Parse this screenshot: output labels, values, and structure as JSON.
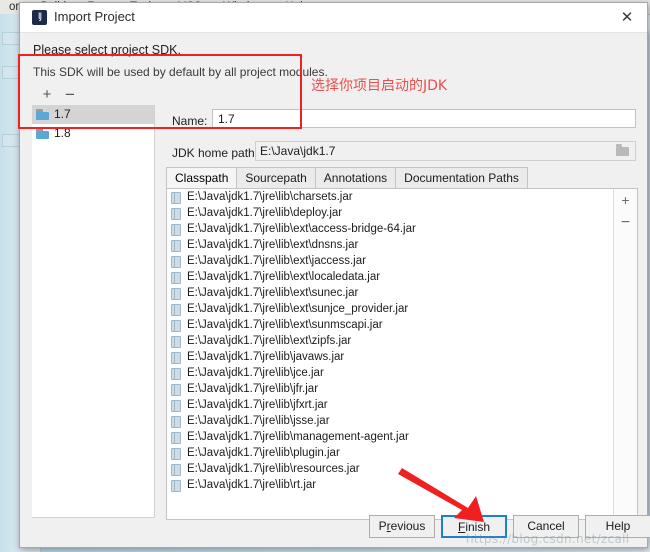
{
  "ide": {
    "menubar": [
      "or",
      "Build",
      "Run",
      "Tools",
      "VCS",
      "Window",
      "Help"
    ]
  },
  "dialog": {
    "title": "Import Project",
    "app_icon": "intellij-idea-icon",
    "close_icon": "✕",
    "heading_primary": "Please select project SDK.",
    "heading_secondary": "This SDK will be used by default by all project modules."
  },
  "sdk_panel": {
    "add_label": "+",
    "remove_label": "−",
    "items": [
      {
        "label": "1.7",
        "selected": true
      },
      {
        "label": "1.8",
        "selected": false
      }
    ]
  },
  "detail": {
    "name_label": "Name:",
    "name_value": "1.7",
    "name_placeholder": "",
    "jdk_path_label": "JDK home path:",
    "jdk_path_value": "E:\\Java\\jdk1.7",
    "browse_icon": "folder-icon"
  },
  "tabs": [
    {
      "label": "Classpath",
      "active": true
    },
    {
      "label": "Sourcepath",
      "active": false
    },
    {
      "label": "Annotations",
      "active": false
    },
    {
      "label": "Documentation Paths",
      "active": false
    }
  ],
  "classpath": {
    "add_label": "+",
    "remove_label": "−",
    "entries": [
      "E:\\Java\\jdk1.7\\jre\\lib\\charsets.jar",
      "E:\\Java\\jdk1.7\\jre\\lib\\deploy.jar",
      "E:\\Java\\jdk1.7\\jre\\lib\\ext\\access-bridge-64.jar",
      "E:\\Java\\jdk1.7\\jre\\lib\\ext\\dnsns.jar",
      "E:\\Java\\jdk1.7\\jre\\lib\\ext\\jaccess.jar",
      "E:\\Java\\jdk1.7\\jre\\lib\\ext\\localedata.jar",
      "E:\\Java\\jdk1.7\\jre\\lib\\ext\\sunec.jar",
      "E:\\Java\\jdk1.7\\jre\\lib\\ext\\sunjce_provider.jar",
      "E:\\Java\\jdk1.7\\jre\\lib\\ext\\sunmscapi.jar",
      "E:\\Java\\jdk1.7\\jre\\lib\\ext\\zipfs.jar",
      "E:\\Java\\jdk1.7\\jre\\lib\\javaws.jar",
      "E:\\Java\\jdk1.7\\jre\\lib\\jce.jar",
      "E:\\Java\\jdk1.7\\jre\\lib\\jfr.jar",
      "E:\\Java\\jdk1.7\\jre\\lib\\jfxrt.jar",
      "E:\\Java\\jdk1.7\\jre\\lib\\jsse.jar",
      "E:\\Java\\jdk1.7\\jre\\lib\\management-agent.jar",
      "E:\\Java\\jdk1.7\\jre\\lib\\plugin.jar",
      "E:\\Java\\jdk1.7\\jre\\lib\\resources.jar",
      "E:\\Java\\jdk1.7\\jre\\lib\\rt.jar"
    ]
  },
  "buttons": {
    "previous": {
      "pre": "P",
      "mn": "r",
      "post": "evious"
    },
    "finish": {
      "pre": "",
      "mn": "F",
      "post": "inish"
    },
    "cancel": {
      "pre": "",
      "mn": "",
      "post": "Cancel"
    },
    "help": {
      "pre": "",
      "mn": "",
      "post": "Help"
    }
  },
  "annotations": {
    "note_text": "选择你项目启动的JDK",
    "note_color": "#ef4d4d",
    "rect_color": "#ee2222",
    "arrow_color": "#f02020",
    "watermark": "https://blog.csdn.net/zcall"
  }
}
